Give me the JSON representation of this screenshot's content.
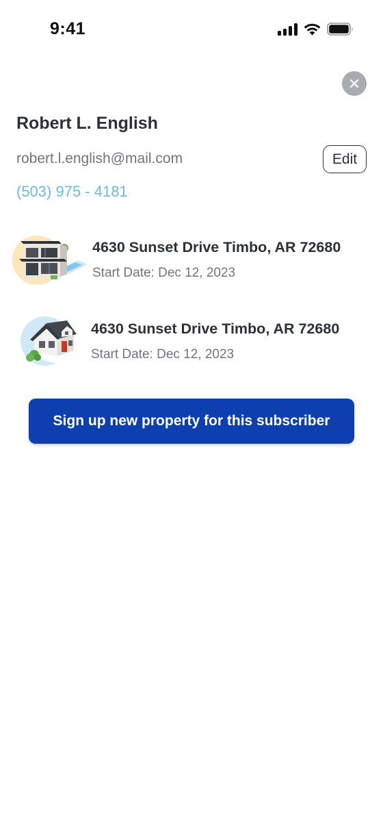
{
  "status_bar": {
    "time": "9:41",
    "icons": [
      "signal-icon",
      "wifi-icon",
      "battery-icon"
    ]
  },
  "subscriber": {
    "name": "Robert L. English",
    "email": "robert.l.english@mail.com",
    "phone": "(503) 975 - 4181",
    "edit_label": "Edit"
  },
  "properties": [
    {
      "address": "4630 Sunset Drive Timbo, AR 72680",
      "start_date": "Start Date: Dec 12, 2023",
      "icon": "modern-house-icon"
    },
    {
      "address": "4630 Sunset Drive Timbo, AR 72680",
      "start_date": "Start Date: Dec 12, 2023",
      "icon": "cottage-house-icon"
    }
  ],
  "actions": {
    "signup_label": "Sign up new property for this subscriber",
    "close_icon": "close-icon"
  },
  "colors": {
    "primary": "#0d3fb0",
    "link": "#6cb9e6",
    "text": "#2b3138",
    "muted": "#6f757c",
    "close_bg": "#a7acb2"
  }
}
